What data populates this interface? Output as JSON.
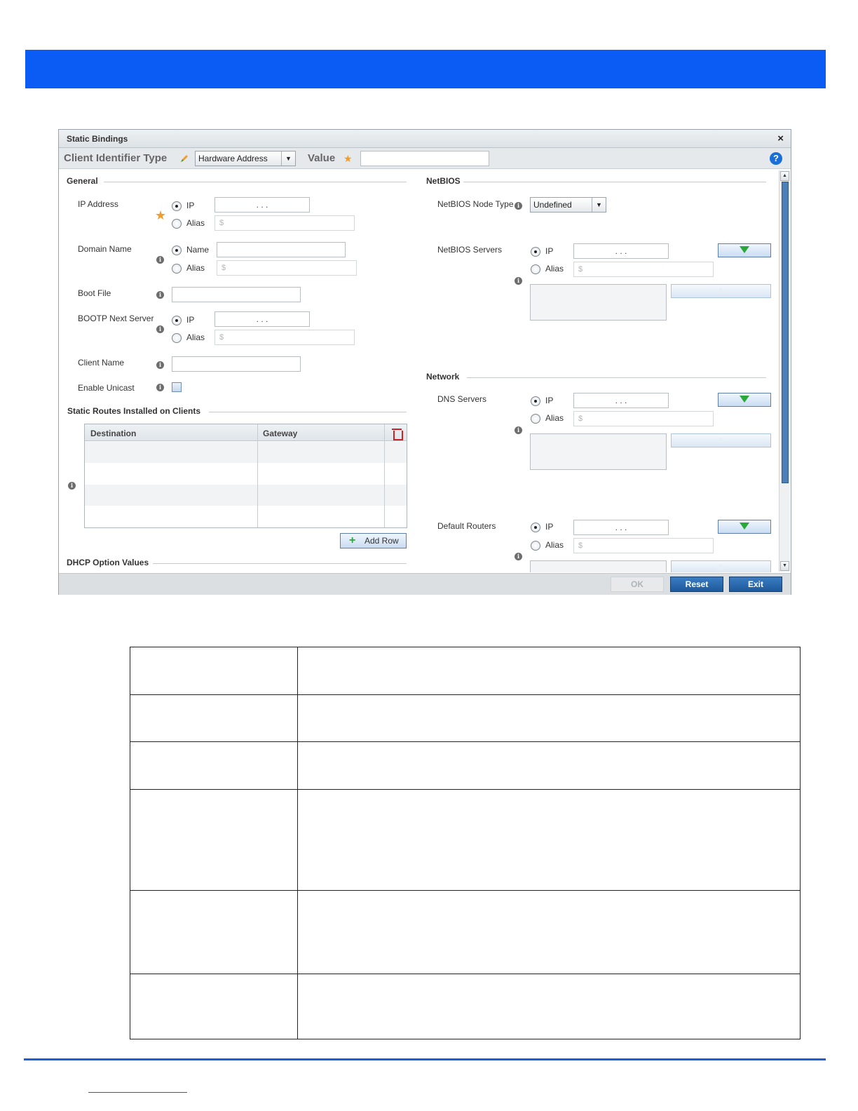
{
  "dialog": {
    "title": "Static Bindings",
    "close_glyph": "×",
    "client_identifier_type_label": "Client Identifier Type",
    "client_identifier_type_value": "Hardware Address",
    "value_label": "Value",
    "value_input": "",
    "help_glyph": "?",
    "required_glyph": "★"
  },
  "general": {
    "section_title": "General",
    "ip_address": {
      "label": "IP Address",
      "ip_option": "IP",
      "alias_option": "Alias",
      "ip_value": "",
      "alias_placeholder": "$",
      "selected": "IP"
    },
    "domain_name": {
      "label": "Domain Name",
      "name_option": "Name",
      "alias_option": "Alias",
      "name_value": "",
      "alias_placeholder": "$",
      "selected": "Name"
    },
    "boot_file": {
      "label": "Boot File",
      "value": ""
    },
    "bootp_next_server": {
      "label": "BOOTP Next Server",
      "ip_option": "IP",
      "alias_option": "Alias",
      "alias_placeholder": "$",
      "selected": "IP"
    },
    "client_name": {
      "label": "Client Name",
      "value": ""
    },
    "enable_unicast": {
      "label": "Enable Unicast",
      "checked": false
    }
  },
  "static_routes": {
    "section_title": "Static Routes Installed on Clients",
    "columns": [
      "Destination",
      "Gateway"
    ],
    "rows": [],
    "add_row_label": "Add Row"
  },
  "dhcp_option_values": {
    "section_title": "DHCP Option Values"
  },
  "netbios": {
    "section_title": "NetBIOS",
    "node_type": {
      "label": "NetBIOS Node Type",
      "value": "Undefined"
    },
    "servers": {
      "label": "NetBIOS Servers",
      "ip_option": "IP",
      "alias_option": "Alias",
      "alias_placeholder": "$",
      "selected": "IP"
    }
  },
  "network": {
    "section_title": "Network",
    "dns_servers": {
      "label": "DNS Servers",
      "ip_option": "IP",
      "alias_option": "Alias",
      "alias_placeholder": "$",
      "selected": "IP"
    },
    "default_routers": {
      "label": "Default Routers",
      "ip_option": "IP",
      "alias_option": "Alias",
      "alias_placeholder": "$",
      "selected": "IP"
    }
  },
  "footer": {
    "ok_label": "OK",
    "reset_label": "Reset",
    "exit_label": "Exit"
  },
  "ip_dots": ". . .",
  "colors": {
    "banner": "#0a5cf5",
    "accent": "#1e5a9c",
    "footer_line": "#1d5fd6"
  }
}
